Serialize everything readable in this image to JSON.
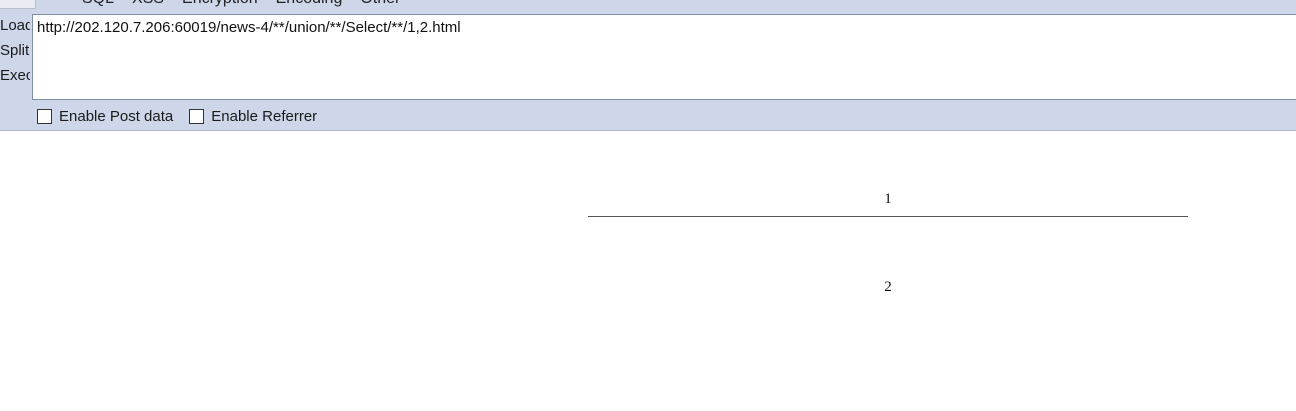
{
  "menu": [
    "SQL",
    "XSS",
    "Encryption",
    "Encoding",
    "Other"
  ],
  "side_actions": [
    "Load URL",
    "Split URL",
    "Execute"
  ],
  "url": "http://202.120.7.206:60019/news-4/**/union/**/Select/**/1,2.html",
  "options": {
    "post_label": "Enable Post data",
    "referrer_label": "Enable Referrer"
  },
  "page": {
    "value1": "1",
    "value2": "2"
  }
}
